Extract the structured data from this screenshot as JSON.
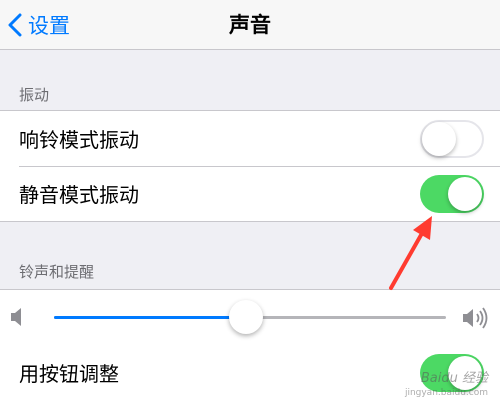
{
  "nav": {
    "back_label": "设置",
    "title": "声音"
  },
  "sections": [
    {
      "header": "振动",
      "rows": [
        {
          "label": "响铃模式振动",
          "on": false
        },
        {
          "label": "静音模式振动",
          "on": true
        }
      ]
    },
    {
      "header": "铃声和提醒",
      "volume": 0.49,
      "rows": [
        {
          "label": "用按钮调整",
          "on": true
        }
      ]
    }
  ],
  "watermark": {
    "text": "Baidu 经验",
    "sub": "jingyan.baidu.com"
  },
  "colors": {
    "accent": "#007aff",
    "switch_on": "#4cd964",
    "arrow": "#ff3b30",
    "background": "#efeff4"
  },
  "icons": [
    "chevron-left-icon",
    "volume-low-icon",
    "volume-high-icon"
  ]
}
